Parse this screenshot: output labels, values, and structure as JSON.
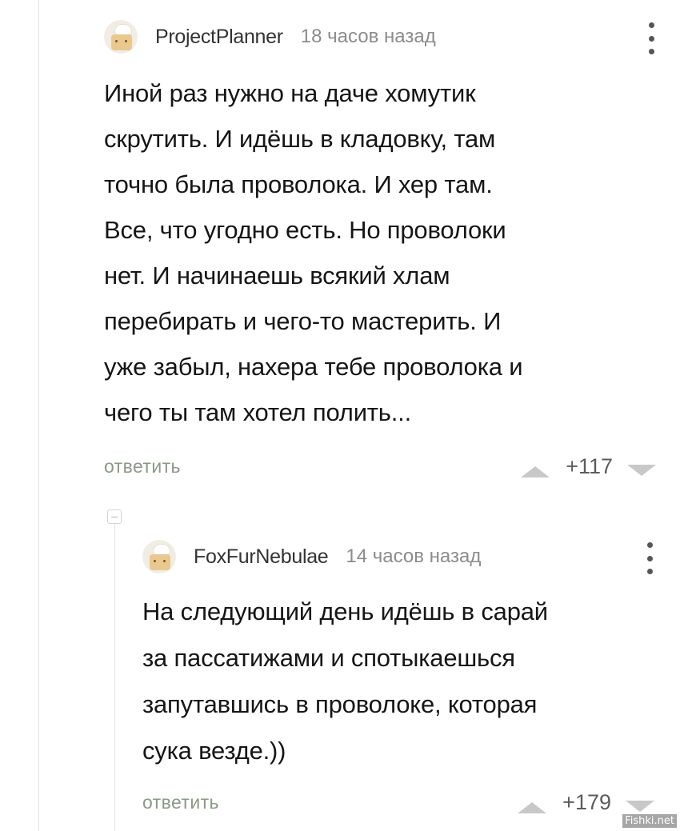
{
  "comments": [
    {
      "username": "ProjectPlanner",
      "time": "18 часов назад",
      "text": "Иной раз нужно на даче хомутик\nскрутить. И идёшь в кладовку, там\nточно была проволока. И хер там.\nВсе, что угодно есть. Но проволоки\nнет. И начинаешь всякий хлам\nперебирать и чего-то мастерить. И\nуже забыл, нахера тебе проволока и\nчего ты там хотел полить...",
      "reply_label": "ответить",
      "rating": "+117",
      "avatar_icon": "chef-avatar-icon"
    },
    {
      "username": "FoxFurNebulae",
      "time": "14 часов назад",
      "text": "На следующий день идёшь в сарай\nза пассатижами и спотыкаешься\nзапутавшись в проволоке, которая\nсука везде.))",
      "reply_label": "ответить",
      "rating": "+179",
      "avatar_icon": "chef-avatar-icon"
    }
  ],
  "watermark": "Fishki.net",
  "colors": {
    "reply": "#8a9a86",
    "vote_arrow": "#c8c8c8",
    "time": "#8c8c8c"
  }
}
